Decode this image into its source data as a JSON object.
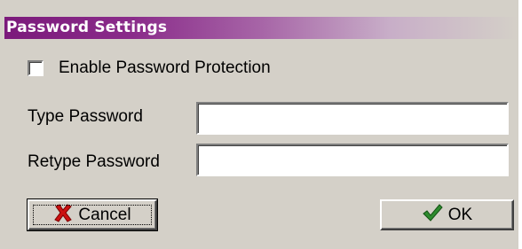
{
  "dialog": {
    "title": "Password Settings",
    "enable_checkbox": {
      "label": "Enable Password Protection",
      "checked": false
    },
    "type_password": {
      "label": "Type Password",
      "value": ""
    },
    "retype_password": {
      "label": "Retype Password",
      "value": ""
    },
    "cancel_button": {
      "label": "Cancel",
      "icon": "red-x-icon"
    },
    "ok_button": {
      "label": "OK",
      "icon": "green-check-icon"
    }
  },
  "colors": {
    "title_start": "#7b1a7b",
    "title_end": "#d4d0c8",
    "face": "#d4d0c8",
    "cancel_icon": "#cc1111",
    "ok_icon": "#2e8b2e"
  }
}
